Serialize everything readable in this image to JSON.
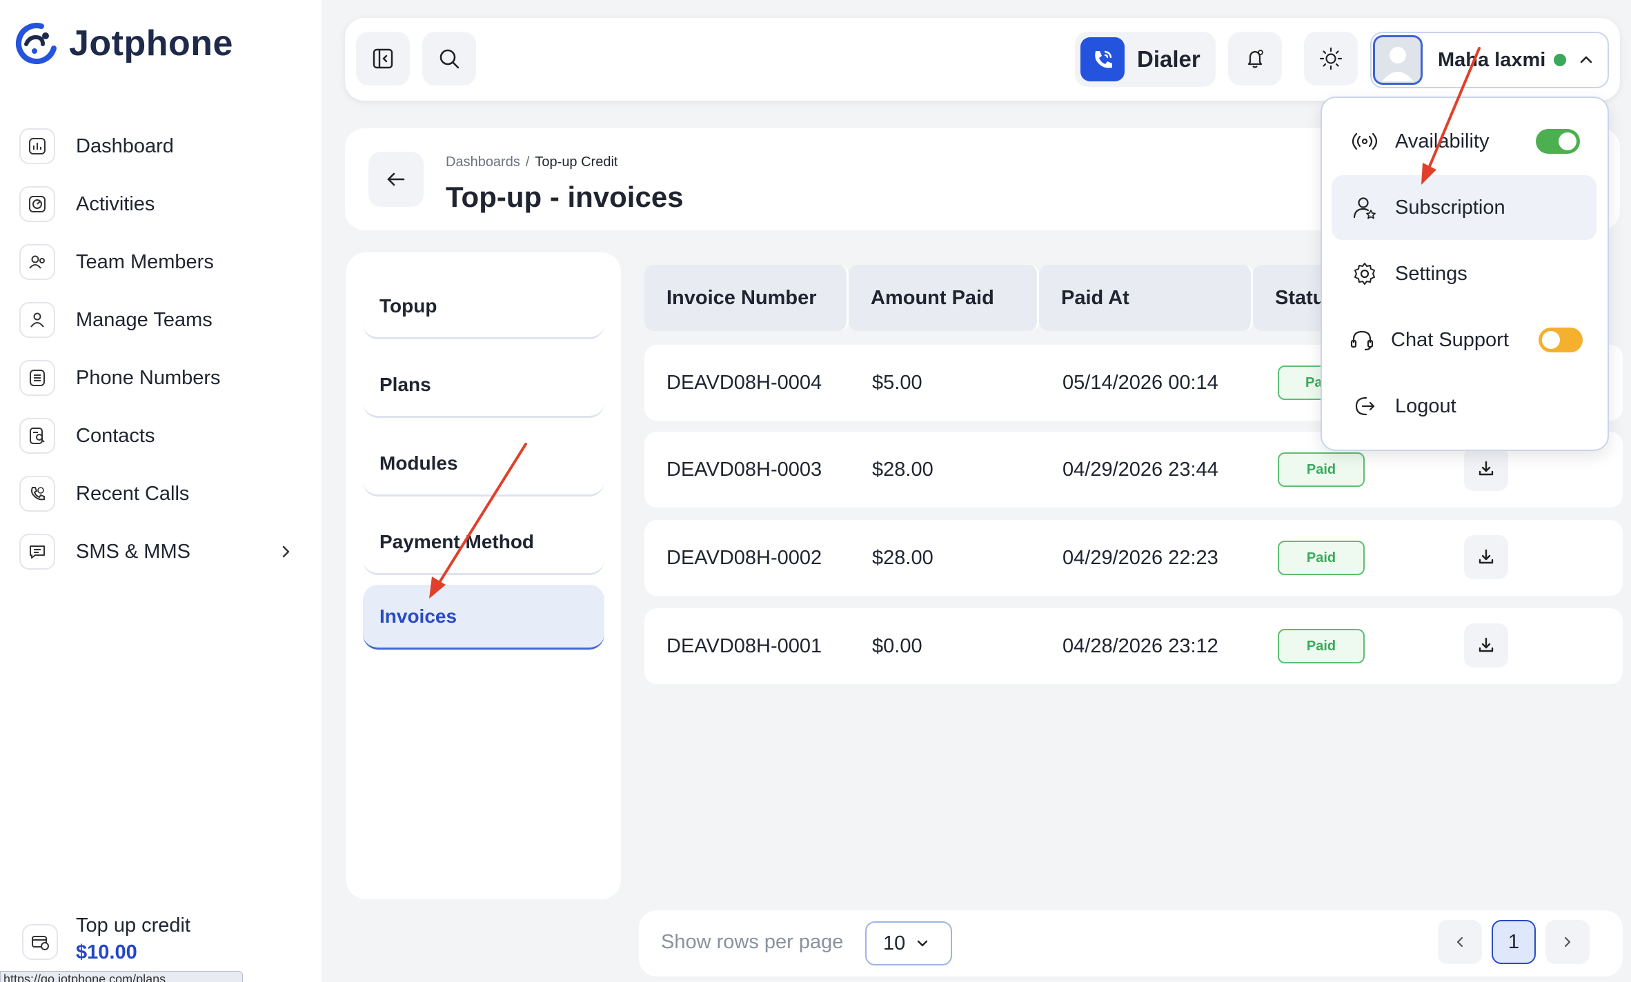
{
  "app": {
    "name": "Jotphone"
  },
  "sidebar": {
    "items": [
      {
        "label": "Dashboard",
        "icon": "dashboard-icon"
      },
      {
        "label": "Activities",
        "icon": "activities-icon"
      },
      {
        "label": "Team Members",
        "icon": "team-members-icon"
      },
      {
        "label": "Manage Teams",
        "icon": "manage-teams-icon"
      },
      {
        "label": "Phone Numbers",
        "icon": "phone-numbers-icon"
      },
      {
        "label": "Contacts",
        "icon": "contacts-icon"
      },
      {
        "label": "Recent Calls",
        "icon": "recent-calls-icon"
      },
      {
        "label": "SMS & MMS",
        "icon": "sms-icon"
      }
    ],
    "credit": {
      "title": "Top up credit",
      "amount": "$10.00"
    },
    "status_url": "https://go.jotphone.com/plans"
  },
  "topbar": {
    "dialer_label": "Dialer",
    "user_name": "Maha laxmi",
    "online_color": "#3aa95a"
  },
  "page": {
    "breadcrumb": [
      "Dashboards",
      "/",
      "Top-up Credit"
    ],
    "title": "Top-up - invoices"
  },
  "tabs": [
    {
      "label": "Topup",
      "active": false
    },
    {
      "label": "Plans",
      "active": false
    },
    {
      "label": "Modules",
      "active": false
    },
    {
      "label": "Payment Method",
      "active": false
    },
    {
      "label": "Invoices",
      "active": true
    }
  ],
  "table": {
    "headers": [
      "Invoice Number",
      "Amount Paid",
      "Paid At",
      "Statu"
    ],
    "rows": [
      {
        "invoice": "DEAVD08H-0004",
        "amount": "$5.00",
        "paid_at": "05/14/2026 00:14",
        "status": "Pa"
      },
      {
        "invoice": "DEAVD08H-0003",
        "amount": "$28.00",
        "paid_at": "04/29/2026 23:44",
        "status": "Paid"
      },
      {
        "invoice": "DEAVD08H-0002",
        "amount": "$28.00",
        "paid_at": "04/29/2026 22:23",
        "status": "Paid"
      },
      {
        "invoice": "DEAVD08H-0001",
        "amount": "$0.00",
        "paid_at": "04/28/2026 23:12",
        "status": "Paid"
      }
    ]
  },
  "pagination": {
    "rows_label": "Show rows per page",
    "rows_value": "10",
    "current_page": "1"
  },
  "profile_menu": {
    "items": [
      {
        "label": "Availability",
        "toggle": true,
        "toggle_on": true,
        "toggle_color": "#4caf50"
      },
      {
        "label": "Subscription",
        "highlighted": true
      },
      {
        "label": "Settings"
      },
      {
        "label": "Chat Support",
        "toggle": true,
        "toggle_on": false,
        "toggle_color": "#f5b02e"
      },
      {
        "label": "Logout"
      }
    ]
  },
  "colors": {
    "brand": "#2453de",
    "accent": "#2b4bc4",
    "paid_green": "#3aa95a",
    "annotation_arrow": "#e0402a"
  }
}
